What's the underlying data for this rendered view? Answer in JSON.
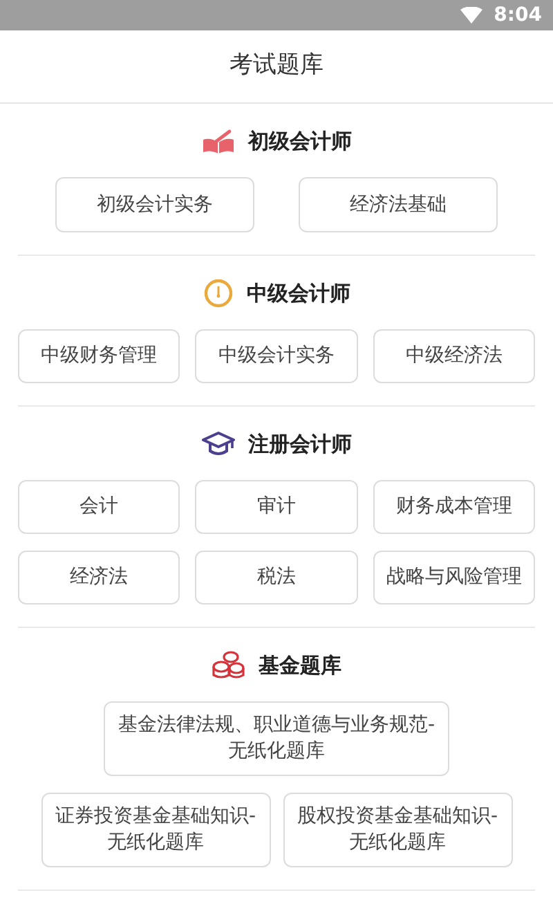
{
  "status_bar": {
    "time": "8:04"
  },
  "header": {
    "title": "考试题库"
  },
  "sections": [
    {
      "kind": "book",
      "title": "初级会计师",
      "items": [
        "初级会计实务",
        "经济法基础"
      ]
    },
    {
      "kind": "clock",
      "title": "中级会计师",
      "items": [
        "中级财务管理",
        "中级会计实务",
        "中级经济法"
      ]
    },
    {
      "kind": "cap",
      "title": "注册会计师",
      "items": [
        "会计",
        "审计",
        "财务成本管理",
        "经济法",
        "税法",
        "战略与风险管理"
      ]
    },
    {
      "kind": "coins",
      "title": "基金题库",
      "items": [
        "基金法律法规、职业道德与业务规范-无纸化题库",
        "证券投资基金基础知识-无纸化题库",
        "股权投资基金基础知识-无纸化题库"
      ]
    }
  ]
}
